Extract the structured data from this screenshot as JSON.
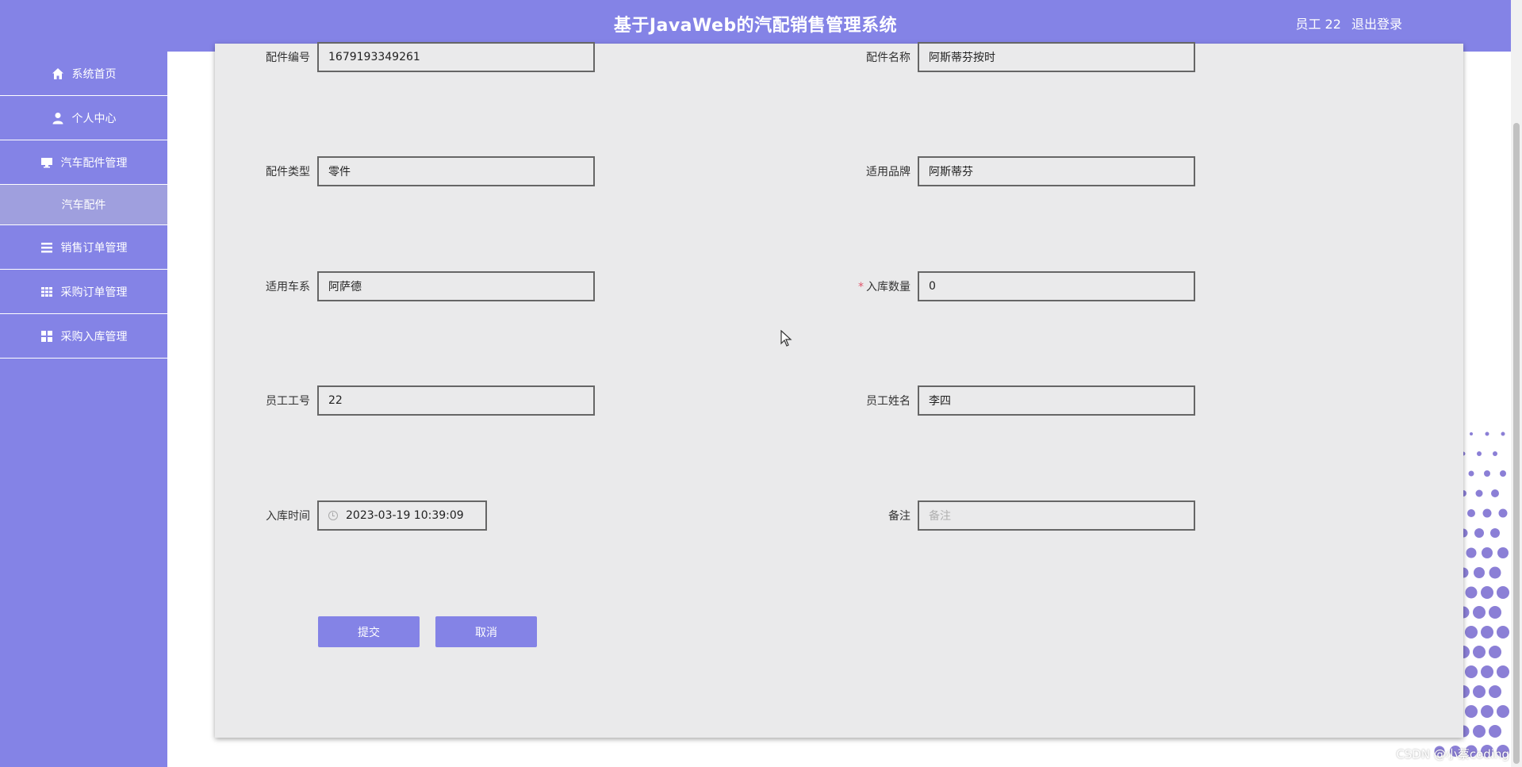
{
  "header": {
    "title": "基于JavaWeb的汽配销售管理系统",
    "user_label": "员工 22",
    "logout_label": "退出登录"
  },
  "sidebar": {
    "items": [
      {
        "label": "系统首页",
        "icon": "home-icon"
      },
      {
        "label": "个人中心",
        "icon": "user-icon"
      },
      {
        "label": "汽车配件管理",
        "icon": "monitor-icon"
      },
      {
        "label": "汽车配件",
        "icon": ""
      },
      {
        "label": "销售订单管理",
        "icon": "list-icon"
      },
      {
        "label": "采购订单管理",
        "icon": "table-icon"
      },
      {
        "label": "采购入库管理",
        "icon": "grid-icon"
      }
    ]
  },
  "form": {
    "part_no": {
      "label": "配件编号",
      "value": "1679193349261"
    },
    "part_name": {
      "label": "配件名称",
      "value": "阿斯蒂芬按时"
    },
    "part_type": {
      "label": "配件类型",
      "value": "零件"
    },
    "brand": {
      "label": "适用品牌",
      "value": "阿斯蒂芬"
    },
    "series": {
      "label": "适用车系",
      "value": "阿萨德"
    },
    "quantity": {
      "label": "入库数量",
      "value": "0",
      "required_mark": "*"
    },
    "employee_no": {
      "label": "员工工号",
      "value": "22"
    },
    "employee_name": {
      "label": "员工姓名",
      "value": "李四"
    },
    "stock_time": {
      "label": "入库时间",
      "value": "2023-03-19 10:39:09"
    },
    "remark": {
      "label": "备注",
      "placeholder": "备注"
    }
  },
  "buttons": {
    "submit": "提交",
    "cancel": "取消"
  },
  "watermark": "CSDN @小蔡coding",
  "colors": {
    "accent": "#8483e6",
    "card": "#eaeaeb"
  }
}
